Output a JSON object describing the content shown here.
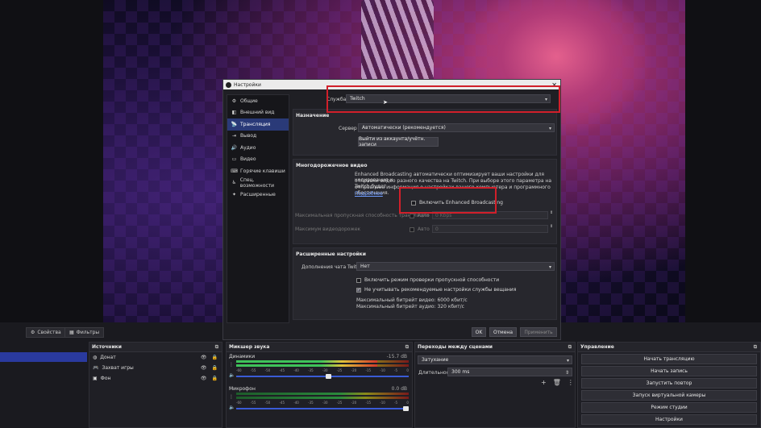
{
  "dialog": {
    "title": "Настройки",
    "nav": [
      {
        "label": "Общие",
        "icon": "gear-icon"
      },
      {
        "label": "Внешний вид",
        "icon": "appearance-icon"
      },
      {
        "label": "Трансляция",
        "icon": "broadcast-icon"
      },
      {
        "label": "Вывод",
        "icon": "output-icon"
      },
      {
        "label": "Аудио",
        "icon": "speaker-icon"
      },
      {
        "label": "Видео",
        "icon": "monitor-icon"
      },
      {
        "label": "Горячие клавиши",
        "icon": "keyboard-icon"
      },
      {
        "label": "Спец. возможности",
        "icon": "accessibility-icon"
      },
      {
        "label": "Расширенные",
        "icon": "tools-icon"
      }
    ],
    "active_nav": "Трансляция",
    "service_label": "Служба",
    "service_value": "Twitch",
    "destination_header": "Назначение",
    "server_label": "Сервер",
    "server_value": "Автоматически (рекомендуется)",
    "logout_button": "Выйти из аккаунта/учётн. записи",
    "multitrack_header": "Многодорожечное видео",
    "eb_description_1": "Enhanced Broadcasting автоматически оптимизирует ваши настройки для кодирования и",
    "eb_description_2": "отправки видео разного качества на Twitch. При выборе этого параметра на Twitch будет",
    "eb_description_3": "отправлена информация о настройках вашего компьютера и программного обеспечения.",
    "more_link": "Подробнее",
    "eb_checkbox": "Включить Enhanced Broadcasting",
    "max_bandwidth_label": "Максимальная пропускная способность трансляции",
    "max_bandwidth_auto": "Авто",
    "max_bandwidth_value": "0 Kbps",
    "max_tracks_label": "Максимум видеодорожек",
    "max_tracks_auto": "Авто",
    "max_tracks_value": "0",
    "advanced_header": "Расширенные настройки",
    "chat_addon_label": "Дополнения чата Twitch",
    "chat_addon_value": "Нет",
    "bwtest_checkbox": "Включить режим проверки пропускной способности",
    "ignore_checkbox": "Не учитывать рекомендуемые настройки службы вещания",
    "max_video_bitrate": "Максимальный битрейт видео: 6000 кбит/с",
    "max_audio_bitrate": "Максимальный битрейт аудио: 320 кбит/с",
    "ok": "OK",
    "cancel": "Отмена",
    "apply": "Применить"
  },
  "bottom": {
    "properties_tab": "Свойства",
    "filters_tab": "Фильтры",
    "sources_header": "Источники",
    "sources": [
      {
        "label": "Донат",
        "icon": "globe-icon"
      },
      {
        "label": "Захват игры",
        "icon": "gamepad-icon"
      },
      {
        "label": "Фон",
        "icon": "image-icon"
      }
    ],
    "mixer_header": "Микшер звука",
    "channels": [
      {
        "name": "Динамики",
        "db": "-15.7 dB",
        "level": 0.82,
        "volume": 0.55
      },
      {
        "name": "Микрофон",
        "db": "0.0 dB",
        "level": 0.0,
        "volume": 1.0
      }
    ],
    "meter_ticks": [
      "-60",
      "-55",
      "-50",
      "-45",
      "-40",
      "-35",
      "-30",
      "-25",
      "-20",
      "-15",
      "-10",
      "-5",
      "0"
    ],
    "transitions_header": "Переходы между сценами",
    "transition_value": "Затухание",
    "duration_label": "Длительность",
    "duration_value": "300 ms",
    "controls_header": "Управление",
    "controls": [
      "Начать трансляцию",
      "Начать запись",
      "Запустить повтор",
      "Запуск виртуальной камеры",
      "Режим студии",
      "Настройки"
    ]
  },
  "colors": {
    "accent": "#2a3a78",
    "highlight": "#d11f2a"
  }
}
